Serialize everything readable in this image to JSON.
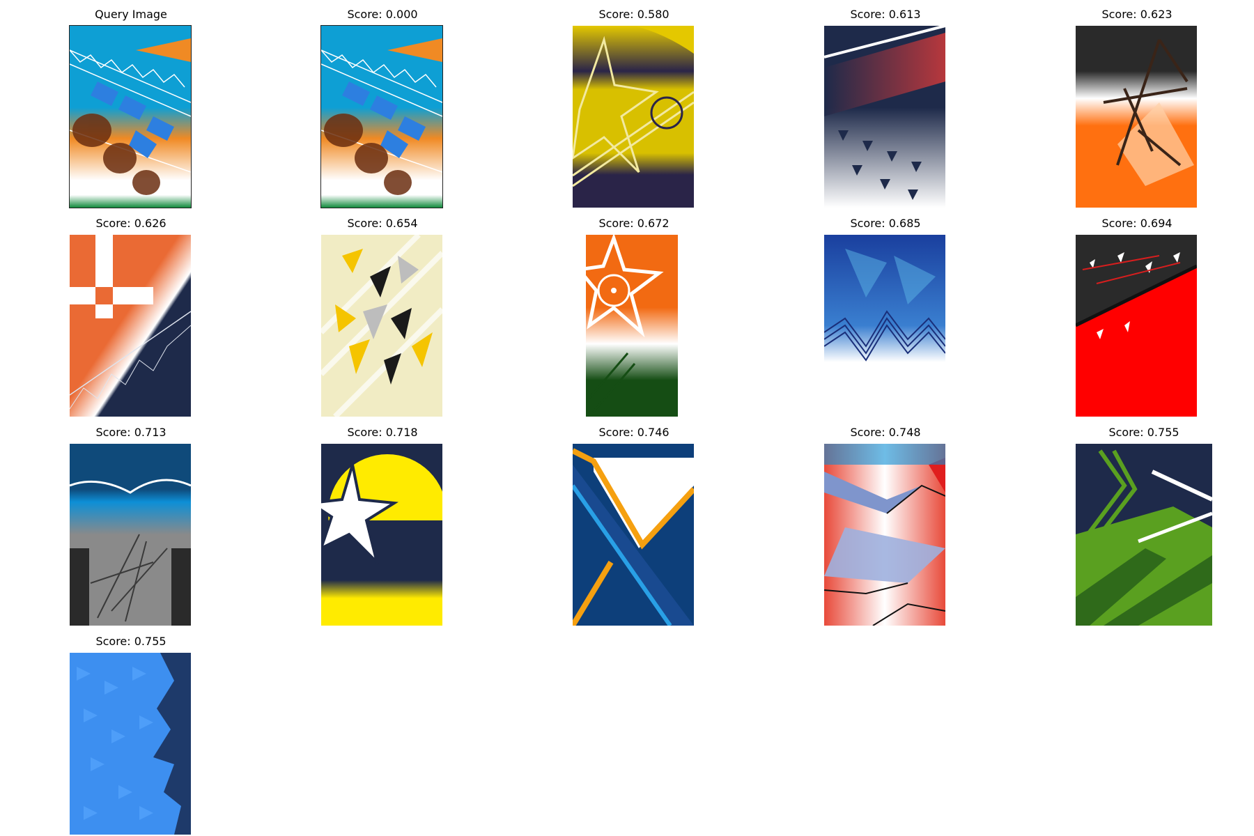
{
  "figure": {
    "query_caption": "Query Image",
    "results": [
      {
        "label": "Score: 0.000",
        "theme": "query-duplicate"
      },
      {
        "label": "Score: 0.580",
        "theme": "yellow-star-lion"
      },
      {
        "label": "Score: 0.613",
        "theme": "navy-red-triangles"
      },
      {
        "label": "Score: 0.623",
        "theme": "orange-black-lattice"
      },
      {
        "label": "Score: 0.626",
        "theme": "orange-cross-navy"
      },
      {
        "label": "Score: 0.654",
        "theme": "cream-yellow-shards"
      },
      {
        "label": "Score: 0.672",
        "theme": "tricolor-star-chakra"
      },
      {
        "label": "Score: 0.685",
        "theme": "blue-polygon-chevrons"
      },
      {
        "label": "Score: 0.694",
        "theme": "red-black-shards"
      },
      {
        "label": "Score: 0.713",
        "theme": "blue-grey-scratches"
      },
      {
        "label": "Score: 0.718",
        "theme": "yellow-navy-star"
      },
      {
        "label": "Score: 0.746",
        "theme": "blue-orange-pattern"
      },
      {
        "label": "Score: 0.748",
        "theme": "red-blue-angular"
      },
      {
        "label": "Score: 0.755",
        "theme": "green-navy-stripes"
      },
      {
        "label": "Score: 0.755",
        "theme": "blue-triangle-mosaic"
      }
    ]
  },
  "colors": {
    "caption_text": "#000000",
    "background": "#ffffff",
    "saffron": "#f08a24",
    "india_green": "#128a3c",
    "navy": "#1e2a4a",
    "sky_blue": "#0e9fd4"
  }
}
